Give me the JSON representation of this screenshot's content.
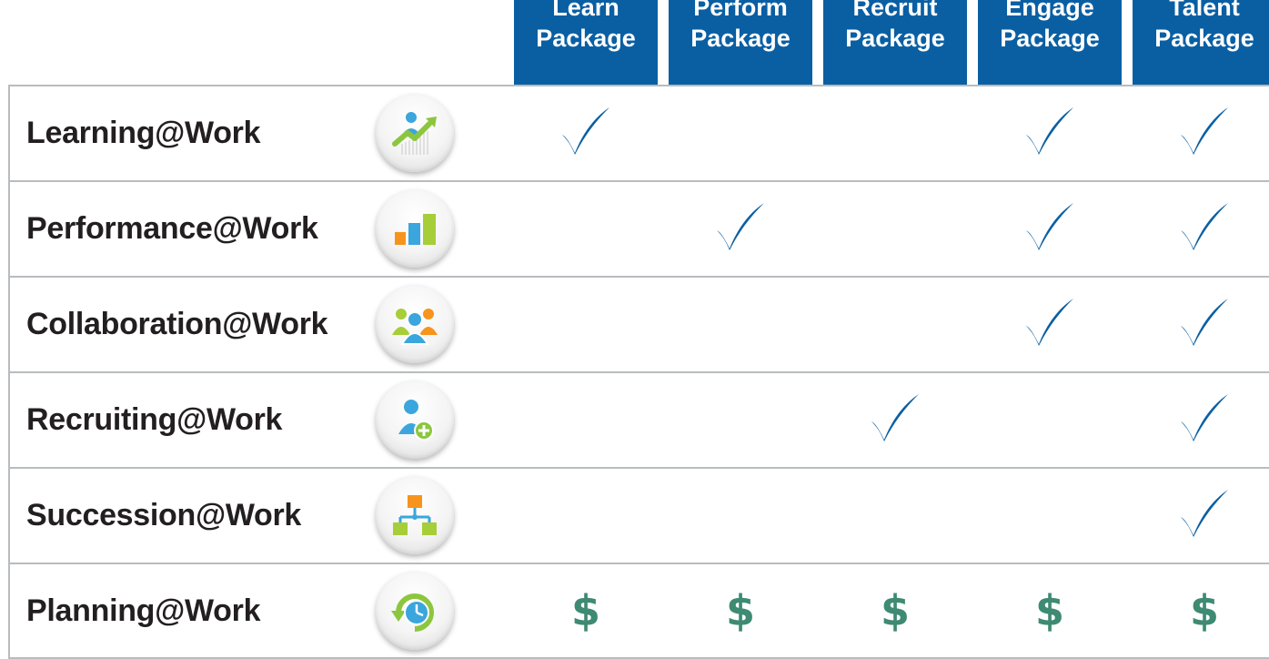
{
  "columns": [
    {
      "line1": "Learn",
      "line2": "Package"
    },
    {
      "line1": "Perform",
      "line2": "Package"
    },
    {
      "line1": "Recruit",
      "line2": "Package"
    },
    {
      "line1": "Engage",
      "line2": "Package"
    },
    {
      "line1": "Talent",
      "line2": "Package"
    }
  ],
  "rows": [
    {
      "label": "Learning@Work",
      "icon": "learning-growth-icon",
      "marks": [
        "check",
        "",
        "",
        "check",
        "check"
      ]
    },
    {
      "label": "Performance@Work",
      "icon": "bar-chart-icon",
      "marks": [
        "",
        "check",
        "",
        "check",
        "check"
      ]
    },
    {
      "label": "Collaboration@Work",
      "icon": "team-people-icon",
      "marks": [
        "",
        "",
        "",
        "check",
        "check"
      ]
    },
    {
      "label": "Recruiting@Work",
      "icon": "add-person-icon",
      "marks": [
        "",
        "",
        "check",
        "",
        "check"
      ]
    },
    {
      "label": "Succession@Work",
      "icon": "org-chart-icon",
      "marks": [
        "",
        "",
        "",
        "",
        "check"
      ]
    },
    {
      "label": "Planning@Work",
      "icon": "clock-refresh-icon",
      "marks": [
        "$",
        "$",
        "$",
        "$",
        "$"
      ]
    }
  ],
  "colors": {
    "header_bg": "#0a5fa3",
    "check": "#0a5fa3",
    "dollar": "#3e8a73",
    "grid": "#b8bcbf"
  }
}
